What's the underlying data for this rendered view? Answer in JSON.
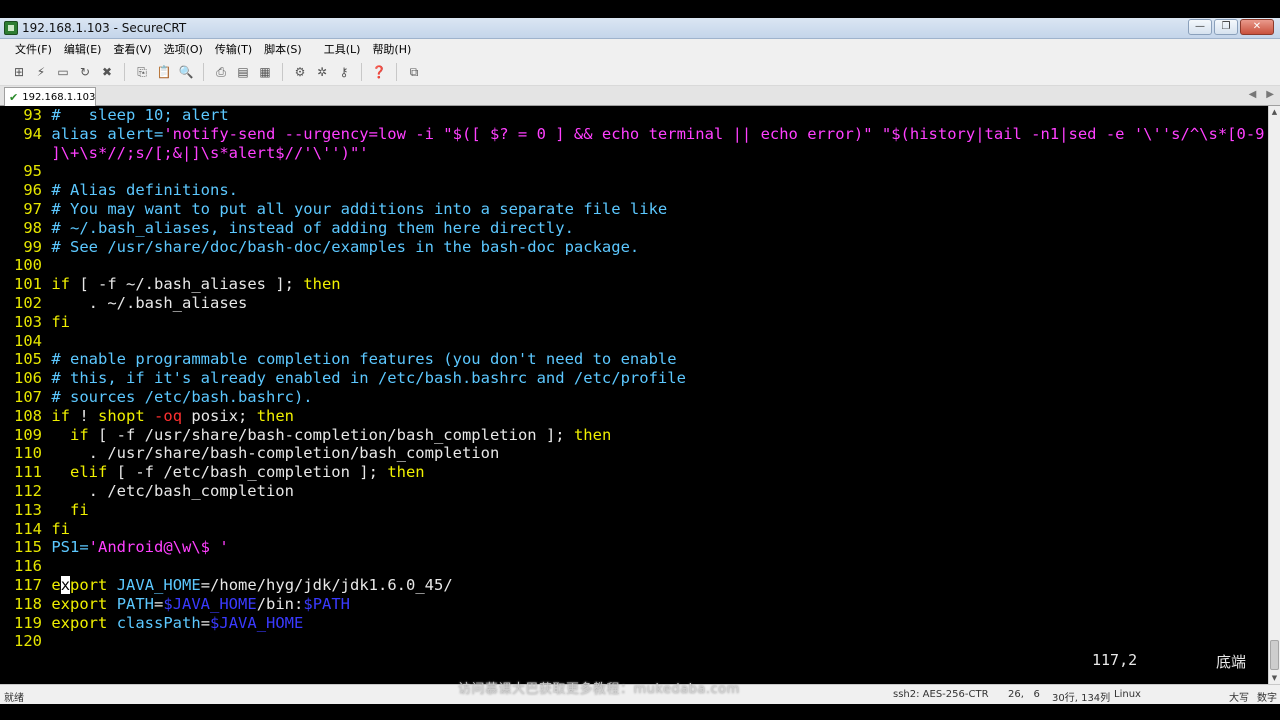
{
  "window": {
    "title": "192.168.1.103 - SecureCRT",
    "min_glyph": "—",
    "max_glyph": "❐",
    "close_glyph": "✕"
  },
  "menu": [
    "文件(F)",
    "编辑(E)",
    "查看(V)",
    "选项(O)",
    "传输(T)",
    "脚本(S)",
    "工具(L)",
    "帮助(H)"
  ],
  "toolbar": {
    "icons": [
      "connect-icon",
      "quick-connect-icon",
      "connect-tab-icon",
      "reconnect-icon",
      "disconnect-icon",
      "copy-icon",
      "paste-icon",
      "find-icon",
      "print-icon",
      "print-setup-icon",
      "print-screen-icon",
      "session-options-icon",
      "global-options-icon",
      "keymap-icon",
      "help-icon",
      "sftp-icon"
    ]
  },
  "tab": {
    "label": "192.168.1.103"
  },
  "terminal": {
    "lines": [
      {
        "n": "93",
        "segs": [
          [
            "cyan",
            "#   sleep 10; alert"
          ]
        ]
      },
      {
        "n": "94",
        "segs": [
          [
            "cyan",
            "alias alert="
          ],
          [
            "magenta",
            "'notify-send --urgency=low -i \"$([ $? = 0 ] && echo terminal || echo error)\" \"$(history|tail -n1|sed -e '\\''s/^\\s*[0-9"
          ]
        ]
      },
      {
        "n": "",
        "segs": [
          [
            "magenta",
            "]\\+\\s*//;s/[;&|]\\s*alert$//'\\'')\"'"
          ]
        ]
      },
      {
        "n": "95",
        "segs": []
      },
      {
        "n": "96",
        "segs": [
          [
            "cyan",
            "# Alias definitions."
          ]
        ]
      },
      {
        "n": "97",
        "segs": [
          [
            "cyan",
            "# You may want to put all your additions into a separate file like"
          ]
        ]
      },
      {
        "n": "98",
        "segs": [
          [
            "cyan",
            "# ~/.bash_aliases, instead of adding them here directly."
          ]
        ]
      },
      {
        "n": "99",
        "segs": [
          [
            "cyan",
            "# See /usr/share/doc/bash-doc/examples in the bash-doc package."
          ]
        ]
      },
      {
        "n": "100",
        "segs": []
      },
      {
        "n": "101",
        "segs": [
          [
            "yellow",
            "if"
          ],
          [
            "white",
            " [ -f ~/.bash_aliases ]; "
          ],
          [
            "yellow",
            "then"
          ]
        ]
      },
      {
        "n": "102",
        "segs": [
          [
            "white",
            "    . ~/.bash_aliases"
          ]
        ]
      },
      {
        "n": "103",
        "segs": [
          [
            "yellow",
            "fi"
          ]
        ]
      },
      {
        "n": "104",
        "segs": []
      },
      {
        "n": "105",
        "segs": [
          [
            "cyan",
            "# enable programmable completion features (you don't need to enable"
          ]
        ]
      },
      {
        "n": "106",
        "segs": [
          [
            "cyan",
            "# this, if it's already enabled in /etc/bash.bashrc and /etc/profile"
          ]
        ]
      },
      {
        "n": "107",
        "segs": [
          [
            "cyan",
            "# sources /etc/bash.bashrc)."
          ]
        ]
      },
      {
        "n": "108",
        "segs": [
          [
            "yellow",
            "if"
          ],
          [
            "white",
            " ! "
          ],
          [
            "yellow",
            "shopt"
          ],
          [
            "white",
            " "
          ],
          [
            "red",
            "-oq"
          ],
          [
            "white",
            " posix; "
          ],
          [
            "yellow",
            "then"
          ]
        ]
      },
      {
        "n": "109",
        "segs": [
          [
            "white",
            "  "
          ],
          [
            "yellow",
            "if"
          ],
          [
            "white",
            " [ -f /usr/share/bash-completion/bash_completion ]; "
          ],
          [
            "yellow",
            "then"
          ]
        ]
      },
      {
        "n": "110",
        "segs": [
          [
            "white",
            "    . /usr/share/bash-completion/bash_completion"
          ]
        ]
      },
      {
        "n": "111",
        "segs": [
          [
            "white",
            "  "
          ],
          [
            "yellow",
            "elif"
          ],
          [
            "white",
            " [ -f /etc/bash_completion ]; "
          ],
          [
            "yellow",
            "then"
          ]
        ]
      },
      {
        "n": "112",
        "segs": [
          [
            "white",
            "    . /etc/bash_completion"
          ]
        ]
      },
      {
        "n": "113",
        "segs": [
          [
            "white",
            "  "
          ],
          [
            "yellow",
            "fi"
          ]
        ]
      },
      {
        "n": "114",
        "segs": [
          [
            "yellow",
            "fi"
          ]
        ]
      },
      {
        "n": "115",
        "segs": [
          [
            "cyan",
            "PS1="
          ],
          [
            "magenta",
            "'Android@\\w\\$ '"
          ]
        ]
      },
      {
        "n": "116",
        "segs": []
      },
      {
        "n": "117",
        "segs": [
          [
            "yellow",
            "e"
          ],
          [
            "cursor",
            "x"
          ],
          [
            "yellow",
            "port"
          ],
          [
            "white",
            " "
          ],
          [
            "cyan",
            "JAVA_HOME"
          ],
          [
            "white",
            "=/home/hyg/jdk/jdk1.6.0_45/"
          ]
        ]
      },
      {
        "n": "118",
        "segs": [
          [
            "yellow",
            "export"
          ],
          [
            "white",
            " "
          ],
          [
            "cyan",
            "PATH"
          ],
          [
            "white",
            "="
          ],
          [
            "blue",
            "$JAVA_HOME"
          ],
          [
            "white",
            "/bin:"
          ],
          [
            "blue",
            "$PATH"
          ]
        ]
      },
      {
        "n": "119",
        "segs": [
          [
            "yellow",
            "export"
          ],
          [
            "white",
            " "
          ],
          [
            "cyan",
            "classPath"
          ],
          [
            "white",
            "="
          ],
          [
            "blue",
            "$JAVA_HOME"
          ]
        ]
      },
      {
        "n": "120",
        "segs": []
      }
    ],
    "position": "117,2",
    "position_label": "底端"
  },
  "statusbar": {
    "ready": "就绪",
    "cipher": "ssh2: AES-256-CTR",
    "cursor": "26,   6",
    "size": "30行, 134列",
    "os": "Linux",
    "caps": "大写",
    "num": "数字"
  },
  "watermark": "访问慕课大巴获取更多教程：mukedaba.com"
}
